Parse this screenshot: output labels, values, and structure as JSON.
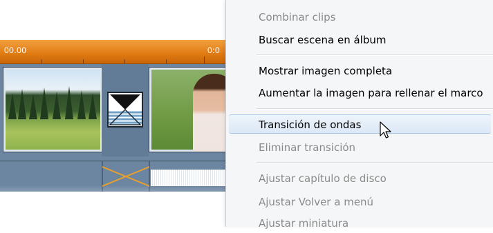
{
  "timeline": {
    "timecodes": [
      "00.00",
      "0:0"
    ],
    "colors": {
      "ruler": "#e07a12",
      "track": "#6c85a0"
    },
    "clips": [
      {
        "name": "clip-landscape",
        "icon": "landscape-thumbnail"
      },
      {
        "name": "clip-portrait",
        "icon": "portrait-thumbnail"
      }
    ],
    "transition_icon": "hourglass-transition-icon"
  },
  "context_menu": {
    "items": [
      {
        "label": "Combinar clips",
        "enabled": false
      },
      {
        "label": "Buscar escena en álbum",
        "enabled": true
      },
      {
        "label": "Mostrar imagen completa",
        "enabled": true
      },
      {
        "label": "Aumentar la imagen para rellenar el marco",
        "enabled": true
      },
      {
        "label": "Transición de ondas",
        "enabled": true,
        "highlighted": true
      },
      {
        "label": "Eliminar transición",
        "enabled": false
      },
      {
        "label": "Ajustar capítulo de disco",
        "enabled": false
      },
      {
        "label": "Ajustar Volver a menú",
        "enabled": false
      },
      {
        "label": "Ajustar miniatura",
        "enabled": false
      }
    ],
    "colors": {
      "highlight": "#dbe8f6",
      "disabled_text": "#8a8a8a"
    }
  },
  "cursor": {
    "icon": "arrow-cursor-icon"
  }
}
